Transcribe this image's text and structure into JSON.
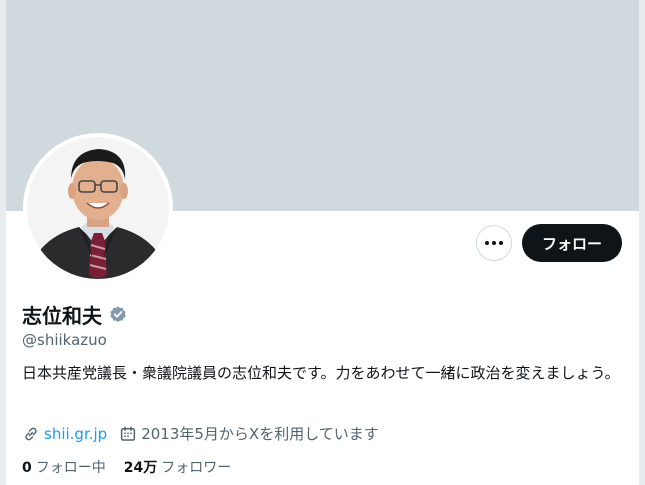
{
  "profile": {
    "name": "志位和夫",
    "handle": "@shiikazuo",
    "bio": "日本共産党議長・衆議院議員の志位和夫です。力をあわせて一緒に政治を変えましょう。",
    "website": "shii.gr.jp",
    "joined": "2013年5月からXを利用しています"
  },
  "actions": {
    "follow_label": "フォロー",
    "more_icon": "more-dots-icon"
  },
  "stats": {
    "following_count": "0",
    "following_label": "フォロー中",
    "followers_count": "24万",
    "followers_label": "フォロワー"
  },
  "colors": {
    "banner": "#cfd9de",
    "follow_button": "#0f1419",
    "link": "#1d9bf0",
    "secondary_text": "#536471",
    "verified_badge": "#829aab"
  }
}
